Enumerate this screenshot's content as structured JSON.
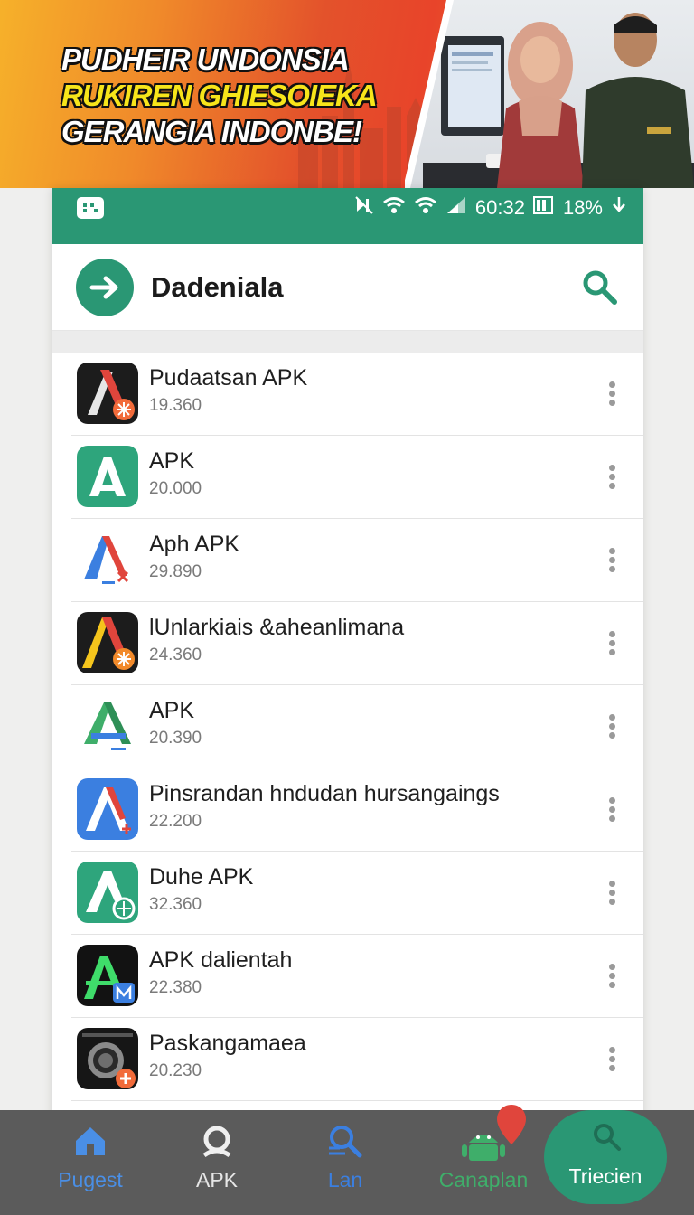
{
  "banner": {
    "headline_line1": "PUDHEIR UNDONSIA",
    "headline_line2": "RUKIREN GHIESOIEKA",
    "headline_line3": "GERANGIA INDONBE!"
  },
  "status_bar": {
    "time": "60:32",
    "battery": "18%",
    "icons": [
      "mute-icon",
      "wifi-icon",
      "wifi-icon",
      "signal-icon",
      "battery-icon",
      "download-icon"
    ]
  },
  "app_bar": {
    "title": "Dadeniala",
    "nav_icon": "arrow-right-icon",
    "action_icon": "search-icon"
  },
  "apps": [
    {
      "name": "Pudaatsan APK",
      "size": "19.360"
    },
    {
      "name": "APK",
      "size": "20.000"
    },
    {
      "name": "Aph APK",
      "size": "29.890"
    },
    {
      "name": "lUnlarkiais &aheanlimana",
      "size": "24.360"
    },
    {
      "name": "APK",
      "size": "20.390"
    },
    {
      "name": "Pinsrandan hndudan hursangaings",
      "size": "22.200"
    },
    {
      "name": "Duhe APK",
      "size": "32.360"
    },
    {
      "name": "APK dalientah",
      "size": "22.380"
    },
    {
      "name": "Paskangamaea",
      "size": "20.230"
    }
  ],
  "bottom_nav": {
    "tabs": [
      {
        "label": "Pugest",
        "icon": "home-icon",
        "color": "#4a8fe6"
      },
      {
        "label": "APK",
        "icon": "search-icon",
        "color": "#e6e6e6"
      },
      {
        "label": "Lan",
        "icon": "search-filter-icon",
        "color": "#3b7fe0"
      },
      {
        "label": "Canaplan",
        "icon": "android-icon",
        "color": "#3fae6a"
      }
    ],
    "active_tab": {
      "label": "Triecien",
      "icon": "search-icon"
    }
  },
  "colors": {
    "accent": "#2a9774",
    "badge_pin": "#e0453c"
  }
}
